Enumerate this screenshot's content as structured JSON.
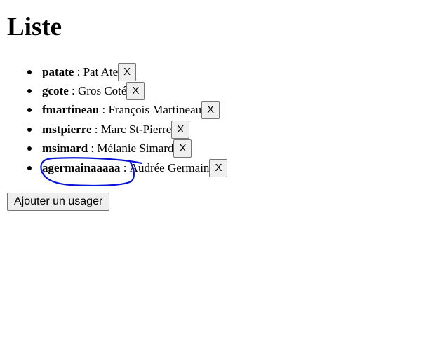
{
  "page": {
    "title": "Liste"
  },
  "users": [
    {
      "login": "patate",
      "name": "Pat Ate",
      "delete_label": "X"
    },
    {
      "login": "gcote",
      "name": "Gros Coté",
      "delete_label": "X"
    },
    {
      "login": "fmartineau",
      "name": "François Martineau",
      "delete_label": "X"
    },
    {
      "login": "mstpierre",
      "name": "Marc St-Pierre",
      "delete_label": "X"
    },
    {
      "login": "msimard",
      "name": "Mélanie Simard",
      "delete_label": "X"
    },
    {
      "login": "agermainaaaaa",
      "name": "Audrée Germain",
      "delete_label": "X"
    }
  ],
  "separator": " : ",
  "add_button": {
    "label": "Ajouter un usager"
  },
  "colors": {
    "annotation_stroke": "#0a14d6"
  }
}
